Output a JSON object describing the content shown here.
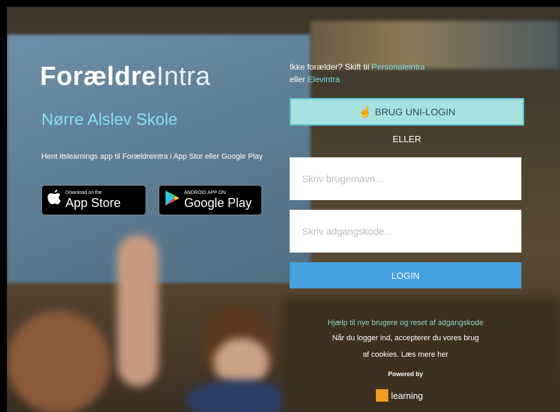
{
  "branding": {
    "logo_bold": "Forældre",
    "logo_light": "Intra",
    "school_name": "Nørre Alslev Skole"
  },
  "app_promo": {
    "hint": "Hent itslearnings app til Forældreintra i App Stor eller Google Play",
    "app_store": {
      "small": "Download on the",
      "big": "App Store"
    },
    "google_play": {
      "small": "ANDROID APP ON",
      "big": "Google Play"
    }
  },
  "switch": {
    "prefix": "Ikke forælder? Skift til",
    "link_staff": "Personaleintra",
    "middle": "eller",
    "link_pupil": "Elevintra"
  },
  "login": {
    "uni_login_label": "BRUG UNI-LOGIN",
    "or_label": "ELLER",
    "username_placeholder": "Skriv brugernavn...",
    "password_placeholder": "Skriv adgangskode...",
    "login_label": "LOGIN"
  },
  "footer": {
    "help_link": "Hjælp til nye brugere og reset af adgangskode",
    "cookie_text": "Når du logger ind, accepterer du vores brug",
    "cookie_text_2": "af cookies. Læs mere her",
    "powered_by": "Powered by",
    "brand_name": "learning"
  },
  "colors": {
    "accent_cyan": "#7fe0ea",
    "uni_button": "#a6e1e0",
    "login_button": "#45a1e0",
    "brand_orange": "#f39b24"
  }
}
